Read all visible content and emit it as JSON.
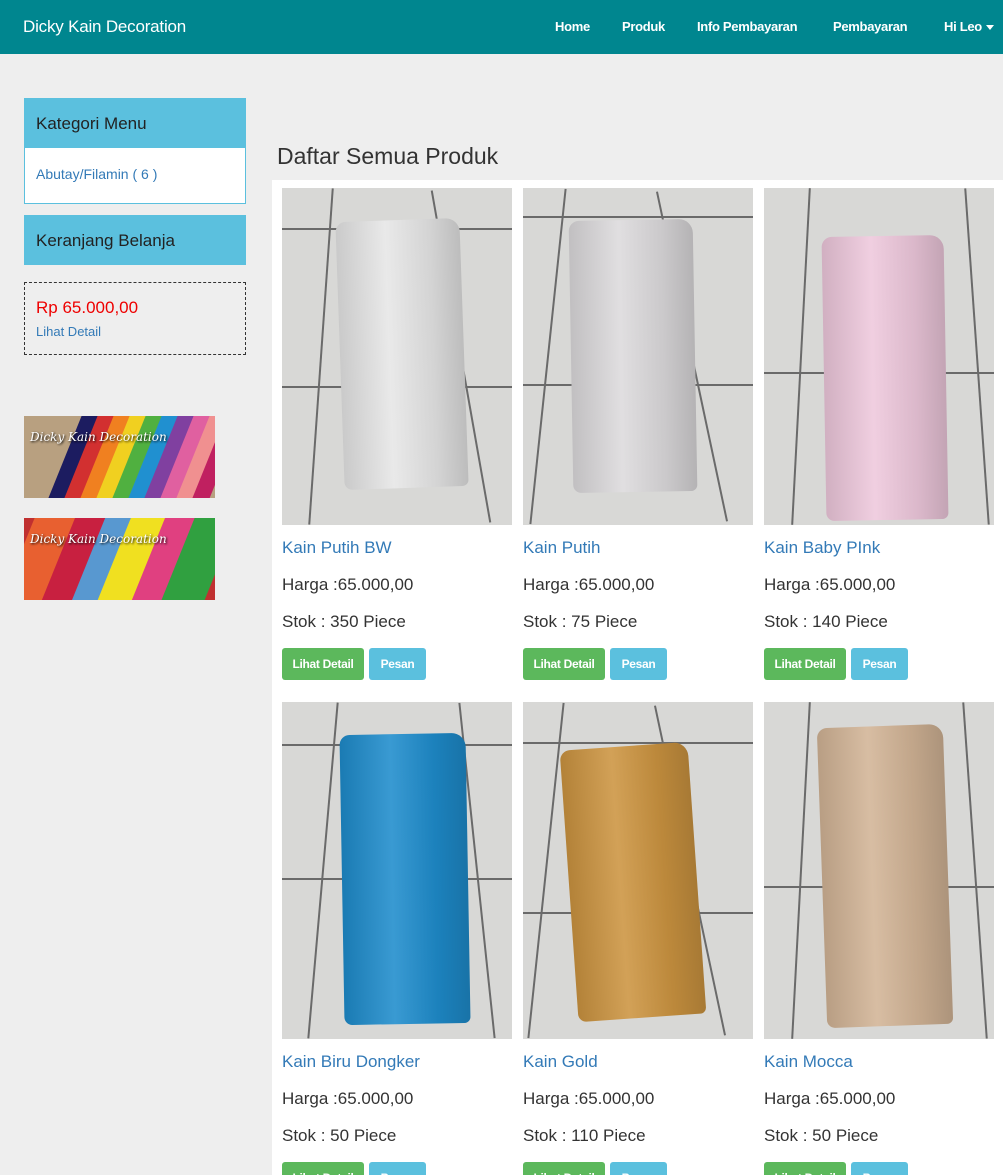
{
  "navbar": {
    "brand": "Dicky Kain Decoration",
    "items": [
      "Home",
      "Produk",
      "Info Pembayaran",
      "Pembayaran",
      "Hi Leo"
    ],
    "bg_color": "#00868f"
  },
  "sidebar": {
    "category_heading": "Kategori Menu",
    "category_link": "Abutay/Filamin ( 6 )",
    "cart_heading": "Keranjang Belanja",
    "cart_total": "Rp 65.000,00",
    "cart_detail_link": "Lihat Detail",
    "banner_text": "Dicky Kain Decoration",
    "accent_color": "#5bc0de"
  },
  "content": {
    "title": "Daftar Semua Produk",
    "detail_button": "Lihat Detail",
    "order_button": "Pesan",
    "products": [
      {
        "name": "Kain Putih BW",
        "price": "Harga :65.000,00",
        "stock": "Stok : 350 Piece",
        "fabric_color": "#e6e6e6"
      },
      {
        "name": "Kain Putih",
        "price": "Harga :65.000,00",
        "stock": "Stok : 75 Piece",
        "fabric_color": "#dcdadc"
      },
      {
        "name": "Kain Baby PInk",
        "price": "Harga :65.000,00",
        "stock": "Stok : 140 Piece",
        "fabric_color": "#eec8dc"
      },
      {
        "name": "Kain Biru Dongker",
        "price": "Harga :65.000,00",
        "stock": "Stok : 50 Piece",
        "fabric_color": "#1e8ccc"
      },
      {
        "name": "Kain Gold",
        "price": "Harga :65.000,00",
        "stock": "Stok : 110 Piece",
        "fabric_color": "#cc9440"
      },
      {
        "name": "Kain Mocca",
        "price": "Harga :65.000,00",
        "stock": "Stok : 50 Piece",
        "fabric_color": "#d2b496"
      }
    ]
  }
}
